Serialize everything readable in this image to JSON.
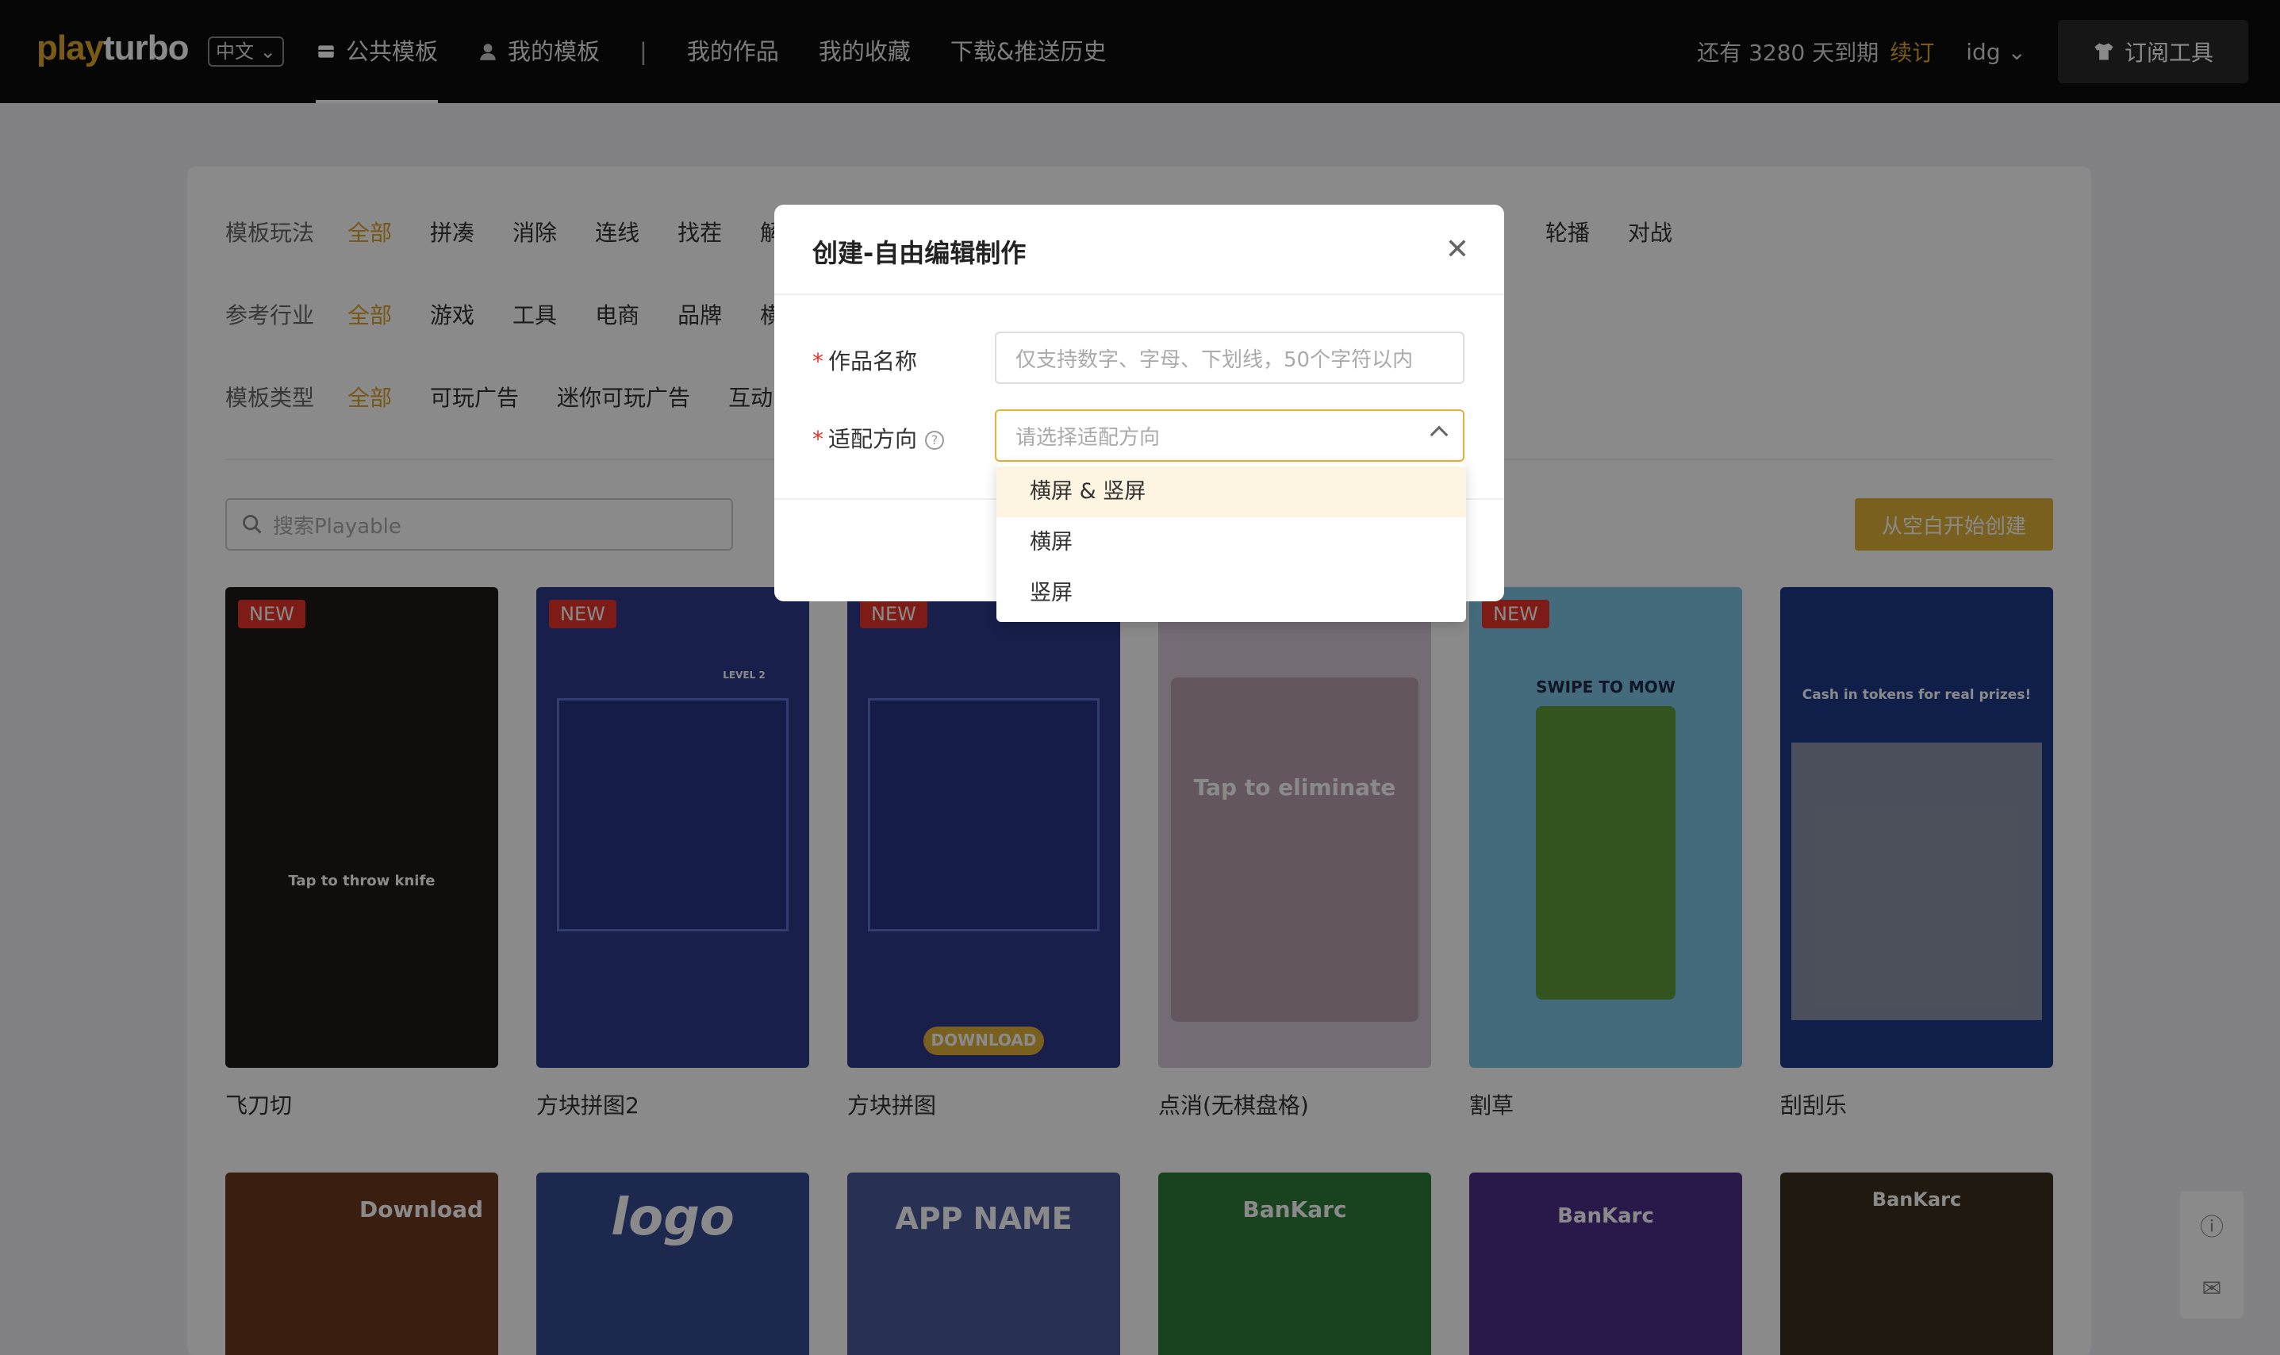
{
  "topbar": {
    "logo_play": "play",
    "logo_turbo": "turbo",
    "lang": "中文",
    "nav": [
      {
        "label": "公共模板",
        "icon": "template-icon"
      },
      {
        "label": "我的模板",
        "icon": "user-icon"
      },
      {
        "label": "|"
      },
      {
        "label": "我的作品"
      },
      {
        "label": "我的收藏"
      },
      {
        "label": "下载&推送历史"
      }
    ],
    "expire": "还有 3280 天到期",
    "renew": "续订",
    "user": "idg",
    "subscribe": "订阅工具"
  },
  "filters": {
    "gameplay": {
      "label": "模板玩法",
      "options": [
        "全部",
        "拼凑",
        "消除",
        "连线",
        "找茬",
        "解",
        "轮播",
        "对战"
      ]
    },
    "industry": {
      "label": "参考行业",
      "options": [
        "全部",
        "游戏",
        "工具",
        "电商",
        "品牌",
        "横"
      ]
    },
    "type": {
      "label": "模板类型",
      "options": [
        "全部",
        "可玩广告",
        "迷你可玩广告",
        "互动"
      ]
    }
  },
  "search": {
    "placeholder": "搜索Playable"
  },
  "create_blank": "从空白开始创建",
  "cards": [
    {
      "title": "飞刀切",
      "badge": "NEW",
      "caption": "Tap to throw knife",
      "color": "#1d1a18"
    },
    {
      "title": "方块拼图2",
      "badge": "NEW",
      "caption": "LEVEL 2",
      "color": "#2b3a8a"
    },
    {
      "title": "方块拼图",
      "badge": "NEW",
      "caption": "DOWNLOAD",
      "color": "#2b3a8a"
    },
    {
      "title": "点消(无棋盘格)",
      "badge": "",
      "caption": "Tap to eliminate",
      "color": "#d6c7d9"
    },
    {
      "title": "割草",
      "badge": "NEW",
      "caption": "SWIPE TO MOW",
      "color": "#7ec6e6"
    },
    {
      "title": "刮刮乐",
      "badge": "",
      "caption": "Cash in tokens for real prizes!",
      "color": "#1e3a8a"
    }
  ],
  "cards_row2": [
    {
      "caption": "Download",
      "color": "#6b3a1f"
    },
    {
      "caption": "logo",
      "color": "#344b8e"
    },
    {
      "caption": "APP NAME",
      "color": "#4b5a9a"
    },
    {
      "caption": "BanKarc",
      "color": "#2f7c3a"
    },
    {
      "caption": "BanKarc",
      "color": "#4d2f8a"
    },
    {
      "caption": "BanKarc",
      "color": "#3a2f1f"
    }
  ],
  "modal": {
    "title": "创建-自由编辑制作",
    "name_label": "作品名称",
    "name_placeholder": "仅支持数字、字母、下划线，50个字符以内",
    "orient_label": "适配方向",
    "orient_placeholder": "请选择适配方向",
    "options": [
      "横屏 & 竖屏",
      "横屏",
      "竖屏"
    ]
  },
  "colors": {
    "accent": "#e2b23a",
    "brand": "#e0a82b",
    "badge": "#e8342b"
  }
}
